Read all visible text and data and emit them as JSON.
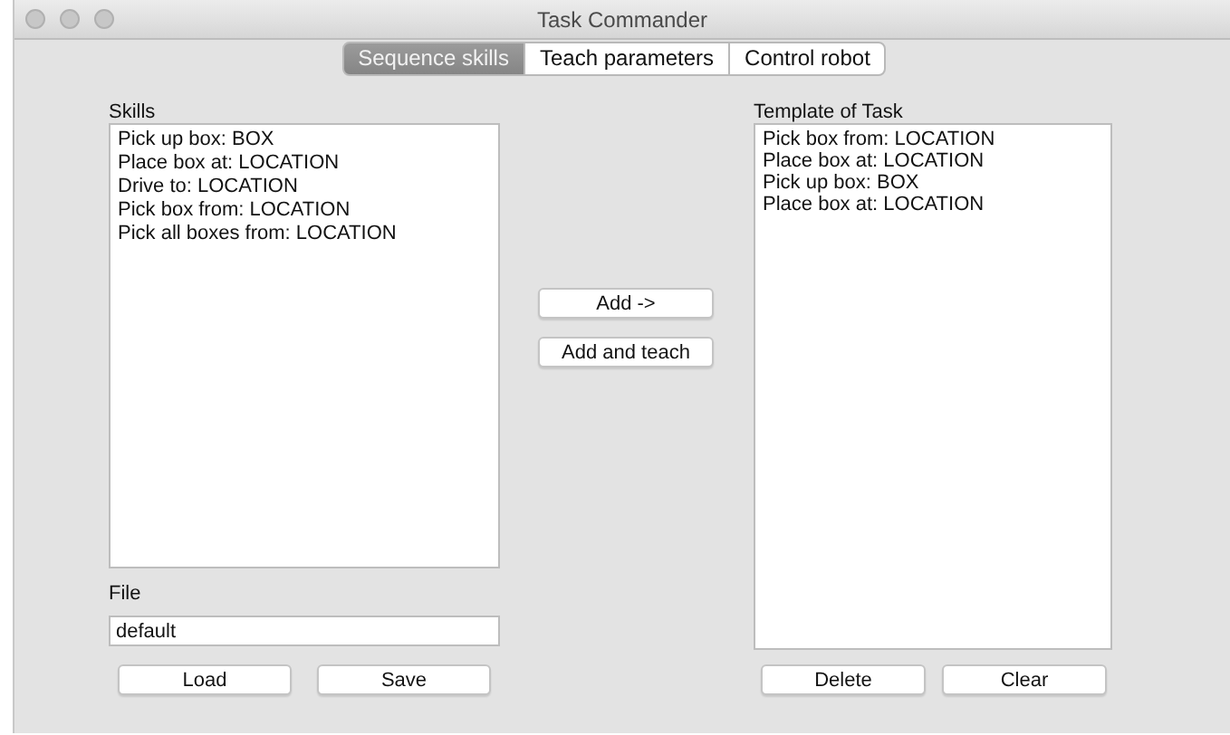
{
  "window": {
    "title": "Task Commander"
  },
  "tabs": [
    {
      "label": "Sequence skills",
      "selected": true
    },
    {
      "label": "Teach parameters",
      "selected": false
    },
    {
      "label": "Control robot",
      "selected": false
    }
  ],
  "skills": {
    "label": "Skills",
    "items": [
      "Pick up box: BOX",
      "Place box at: LOCATION",
      "Drive to: LOCATION",
      "Pick box from: LOCATION",
      "Pick all boxes from: LOCATION"
    ]
  },
  "file": {
    "label": "File",
    "value": "default",
    "buttons": [
      "Load",
      "Save"
    ]
  },
  "middle_buttons": [
    "Add ->",
    "Add and teach"
  ],
  "template": {
    "label": "Template of Task",
    "items": [
      "Pick box from: LOCATION",
      "Place box at: LOCATION",
      "Pick up box: BOX",
      "Place box at: LOCATION"
    ],
    "buttons": [
      "Delete",
      "Clear"
    ]
  }
}
